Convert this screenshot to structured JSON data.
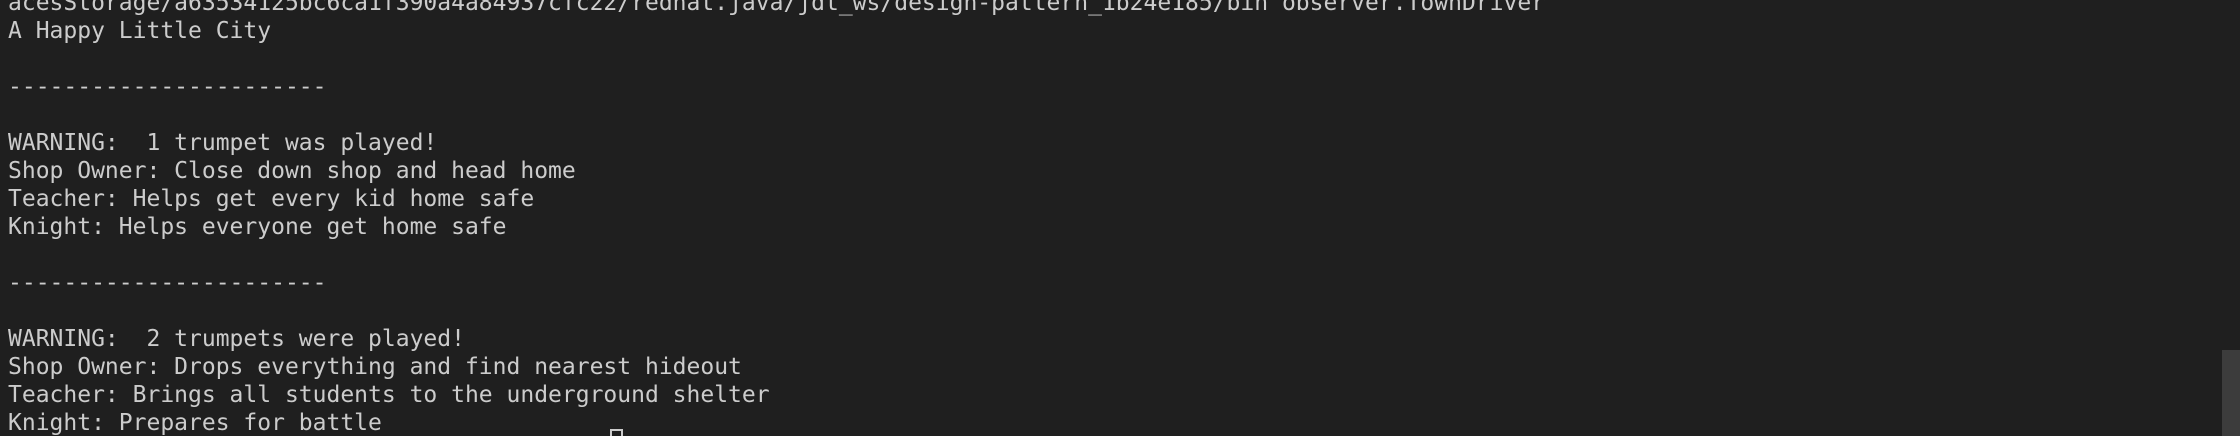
{
  "terminal": {
    "lines": [
      "acesStorage/a63534125bc6ca1f390a4a84937cfc22/redhat.java/jdt_ws/design-pattern_1b24e185/bin observer.TownDriver",
      "A Happy Little City",
      "",
      "-----------------------",
      "",
      "WARNING:  1 trumpet was played!",
      "Shop Owner: Close down shop and head home",
      "Teacher: Helps get every kid home safe",
      "Knight: Helps everyone get home safe",
      "",
      "-----------------------",
      "",
      "WARNING:  2 trumpets were played!",
      "Shop Owner: Drops everything and find nearest hideout",
      "Teacher: Brings all students to the underground shelter",
      "Knight: Prepares for battle"
    ]
  },
  "colors": {
    "background": "#1f1f1f",
    "foreground": "#cccccc",
    "scrollbar_thumb": "#3c3c3c"
  }
}
